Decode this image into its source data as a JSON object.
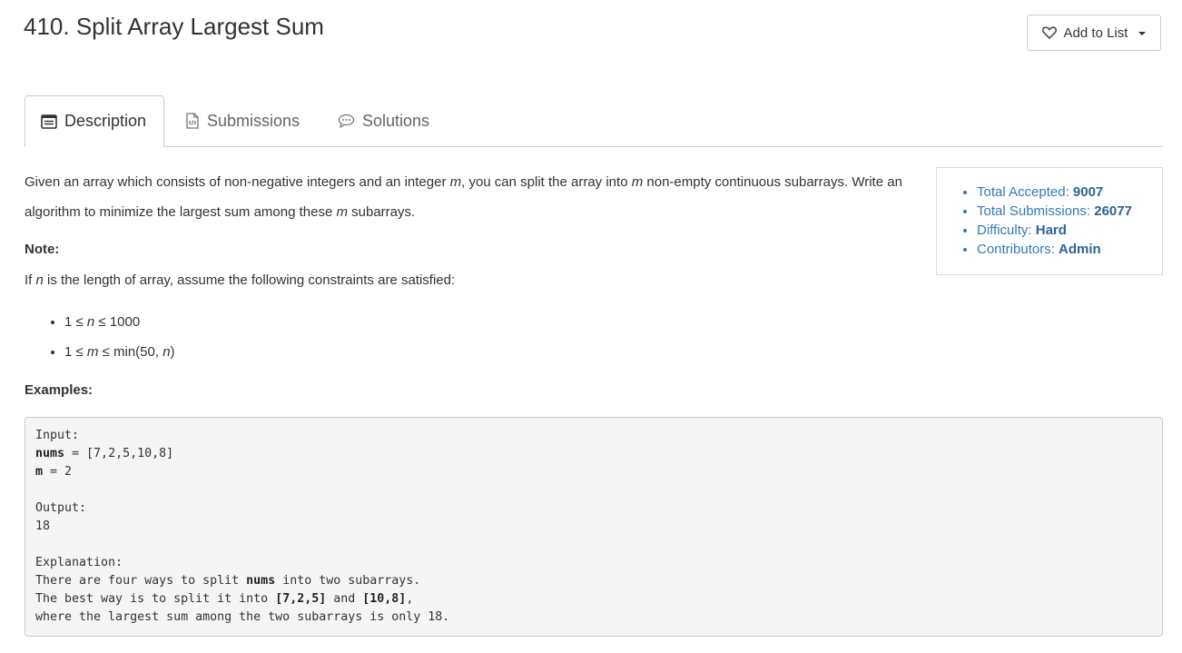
{
  "problem": {
    "title": "410. Split Array Largest Sum"
  },
  "toolbar": {
    "add_to_list_label": "Add to List"
  },
  "tabs": [
    {
      "label": "Description",
      "icon": "description-icon"
    },
    {
      "label": "Submissions",
      "icon": "code-file-icon"
    },
    {
      "label": "Solutions",
      "icon": "chat-bubble-icon"
    }
  ],
  "description": {
    "text_1": "Given an array which consists of non-negative integers and an integer ",
    "m": "m",
    "text_2": ", you can split the array into ",
    "text_3": " non-empty continuous subarrays. Write an algorithm to minimize the largest sum among these ",
    "text_4": " subarrays."
  },
  "note": {
    "heading": "Note:"
  },
  "constraint": {
    "prefix": "If ",
    "n": "n",
    "suffix": " is the length of array, assume the following constraints are satisfied:"
  },
  "constraints": [
    {
      "left": "1 ≤ ",
      "var": "n",
      "right": " ≤ 1000"
    },
    {
      "left": "1 ≤ ",
      "var": "m",
      "right": " ≤ min(50, ",
      "var2": "n",
      "tail": ")"
    }
  ],
  "examples": {
    "heading": "Examples:",
    "input_label": "Input:",
    "nums_key": "nums",
    "nums_value": " = [7,2,5,10,8]",
    "m_key": "m",
    "m_value": " = 2",
    "output_label": "Output:",
    "output_value": "18",
    "explanation_label": "Explanation:",
    "exp_1a": "There are four ways to split ",
    "exp_1b": "nums",
    "exp_1c": " into two subarrays.",
    "exp_2a": "The best way is to split it into ",
    "exp_2b": "[7,2,5]",
    "exp_2c": " and ",
    "exp_2d": "[10,8]",
    "exp_2e": ",",
    "exp_3": "where the largest sum among the two subarrays is only 18."
  },
  "stats": [
    {
      "label": "Total Accepted: ",
      "value": "9007"
    },
    {
      "label": "Total Submissions: ",
      "value": "26077"
    },
    {
      "label": "Difficulty: ",
      "value": "Hard"
    },
    {
      "label": "Contributors: ",
      "value": "Admin"
    }
  ],
  "colors": {
    "link_blue": "#337ab7",
    "code_bg": "#f5f5f5",
    "border": "#cccccc"
  }
}
